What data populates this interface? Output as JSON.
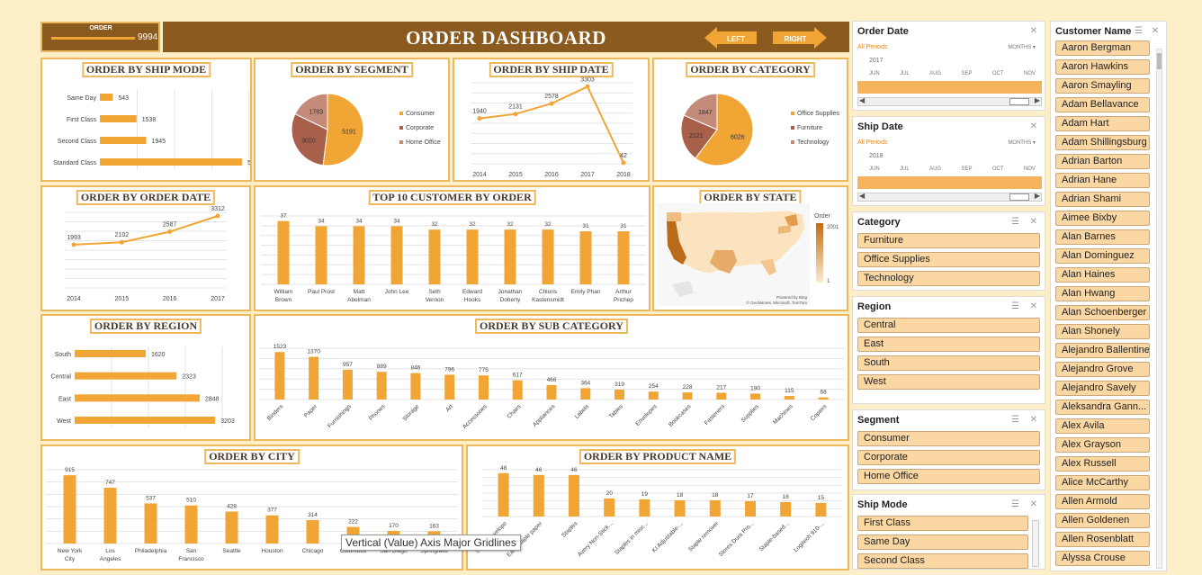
{
  "header": {
    "order_label": "ORDER",
    "order_value": "9994",
    "title": "ORDER DASHBOARD",
    "left_label": "LEFT",
    "right_label": "RIGHT",
    "accent": "#8b5a1e",
    "bar_color": "#f0a535"
  },
  "tooltip": "Vertical (Value) Axis Major Gridlines",
  "charts": {
    "ship_mode": {
      "title": "ORDER BY SHIP MODE"
    },
    "segment": {
      "title": "ORDER BY SEGMENT"
    },
    "ship_date": {
      "title": "ORDER BY SHIP DATE"
    },
    "category": {
      "title": "ORDER BY CATEGORY"
    },
    "order_date": {
      "title": "ORDER BY ORDER DATE"
    },
    "top10": {
      "title": "TOP 10 CUSTOMER BY ORDER"
    },
    "state": {
      "title": "ORDER BY STATE",
      "legend_title": "Order",
      "legend_max": "2001",
      "legend_min": "1",
      "credit1": "Powered by Bing",
      "credit2": "© GeoNames, Microsoft, TomTom"
    },
    "region": {
      "title": "ORDER BY REGION"
    },
    "sub_category": {
      "title": "ORDER BY SUB CATEGORY"
    },
    "city": {
      "title": "ORDER BY CITY"
    },
    "product": {
      "title": "ORDER BY PRODUCT NAME"
    }
  },
  "chart_data": [
    {
      "id": "ship_mode",
      "type": "bar",
      "orientation": "horizontal",
      "categories": [
        "Same Day",
        "First Class",
        "Second Class",
        "Standard Class"
      ],
      "values": [
        543,
        1538,
        1945,
        5968
      ]
    },
    {
      "id": "segment",
      "type": "pie",
      "categories": [
        "Consumer",
        "Corporate",
        "Home Office"
      ],
      "values": [
        5191,
        3020,
        1783
      ],
      "colors": [
        "#f0a535",
        "#a9604a",
        "#c48a7a"
      ]
    },
    {
      "id": "ship_date",
      "type": "line",
      "x": [
        "2014",
        "2015",
        "2016",
        "2017",
        "2018"
      ],
      "values": [
        1940,
        2131,
        2578,
        3303,
        42
      ]
    },
    {
      "id": "category",
      "type": "pie",
      "categories": [
        "Office Supplies",
        "Furniture",
        "Technology"
      ],
      "values": [
        6026,
        2121,
        1847
      ],
      "colors": [
        "#f0a535",
        "#a9604a",
        "#c48a7a"
      ]
    },
    {
      "id": "order_date",
      "type": "line",
      "x": [
        "2014",
        "2015",
        "2016",
        "2017"
      ],
      "values": [
        1993,
        2102,
        2587,
        3312
      ]
    },
    {
      "id": "top10",
      "type": "bar",
      "categories": [
        "William Brown",
        "Paul Prost",
        "Matt Abelman",
        "John Lee",
        "Seth Vernon",
        "Edward Hooks",
        "Jonathan Doherty",
        "Chloris Kastensmidt",
        "Emily Phan",
        "Arthur Prichep"
      ],
      "values": [
        37,
        34,
        34,
        34,
        32,
        32,
        32,
        32,
        31,
        31
      ]
    },
    {
      "id": "region",
      "type": "bar",
      "orientation": "horizontal",
      "categories": [
        "South",
        "Central",
        "East",
        "West"
      ],
      "values": [
        1620,
        2323,
        2848,
        3203
      ]
    },
    {
      "id": "sub_category",
      "type": "bar",
      "categories": [
        "Binders",
        "Paper",
        "Furnishings",
        "Phones",
        "Storage",
        "Art",
        "Accessories",
        "Chairs",
        "Appliances",
        "Labels",
        "Tables",
        "Envelopes",
        "Bookcases",
        "Fasteners",
        "Supplies",
        "Machines",
        "Copiers"
      ],
      "values": [
        1523,
        1370,
        957,
        889,
        846,
        796,
        775,
        617,
        466,
        364,
        319,
        254,
        228,
        217,
        190,
        115,
        68
      ]
    },
    {
      "id": "city",
      "type": "bar",
      "categories": [
        "New York City",
        "Los Angeles",
        "Philadelphia",
        "San Francisco",
        "Seattle",
        "Houston",
        "Chicago",
        "Columbus",
        "San Diego",
        "Springfield"
      ],
      "values": [
        915,
        747,
        537,
        510,
        428,
        377,
        314,
        222,
        170,
        163
      ]
    },
    {
      "id": "product",
      "type": "bar",
      "categories": [
        "Staple envelope",
        "Easy-staple paper",
        "Staples",
        "Avery Non-Stick...",
        "Staples in misc...",
        "KI Adjustable-...",
        "Staple remover",
        "Storex Dura Pro...",
        "Staple-based...",
        "Logitech 910-..."
      ],
      "values": [
        48,
        46,
        46,
        20,
        19,
        18,
        18,
        17,
        16,
        15
      ]
    }
  ],
  "slicers": {
    "order_date": {
      "title": "Order Date",
      "period": "All Periods",
      "unit": "MONTHS",
      "year": "2017",
      "months": [
        "JUN",
        "JUL",
        "AUG",
        "SEP",
        "OCT",
        "NOV"
      ]
    },
    "ship_date": {
      "title": "Ship Date",
      "period": "All Periods",
      "unit": "MONTHS",
      "year": "2018",
      "months": [
        "JUN",
        "JUL",
        "AUG",
        "SEP",
        "OCT",
        "NOV"
      ]
    },
    "category": {
      "title": "Category",
      "items": [
        "Furniture",
        "Office Supplies",
        "Technology"
      ]
    },
    "region": {
      "title": "Region",
      "items": [
        "Central",
        "East",
        "South",
        "West"
      ]
    },
    "segment": {
      "title": "Segment",
      "items": [
        "Consumer",
        "Corporate",
        "Home Office"
      ]
    },
    "ship_mode": {
      "title": "Ship Mode",
      "items": [
        "First Class",
        "Same Day",
        "Second Class"
      ]
    },
    "customer": {
      "title": "Customer Name",
      "items": [
        "Aaron Bergman",
        "Aaron Hawkins",
        "Aaron Smayling",
        "Adam Bellavance",
        "Adam Hart",
        "Adam Shillingsburg",
        "Adrian Barton",
        "Adrian Hane",
        "Adrian Shami",
        "Aimee Bixby",
        "Alan Barnes",
        "Alan Dominguez",
        "Alan Haines",
        "Alan Hwang",
        "Alan Schoenberger",
        "Alan Shonely",
        "Alejandro Ballentine",
        "Alejandro Grove",
        "Alejandro Savely",
        "Aleksandra Gann...",
        "Alex Avila",
        "Alex Grayson",
        "Alex Russell",
        "Alice McCarthy",
        "Allen Armold",
        "Allen Goldenen",
        "Allen Rosenblatt",
        "Alyssa Crouse"
      ]
    }
  }
}
